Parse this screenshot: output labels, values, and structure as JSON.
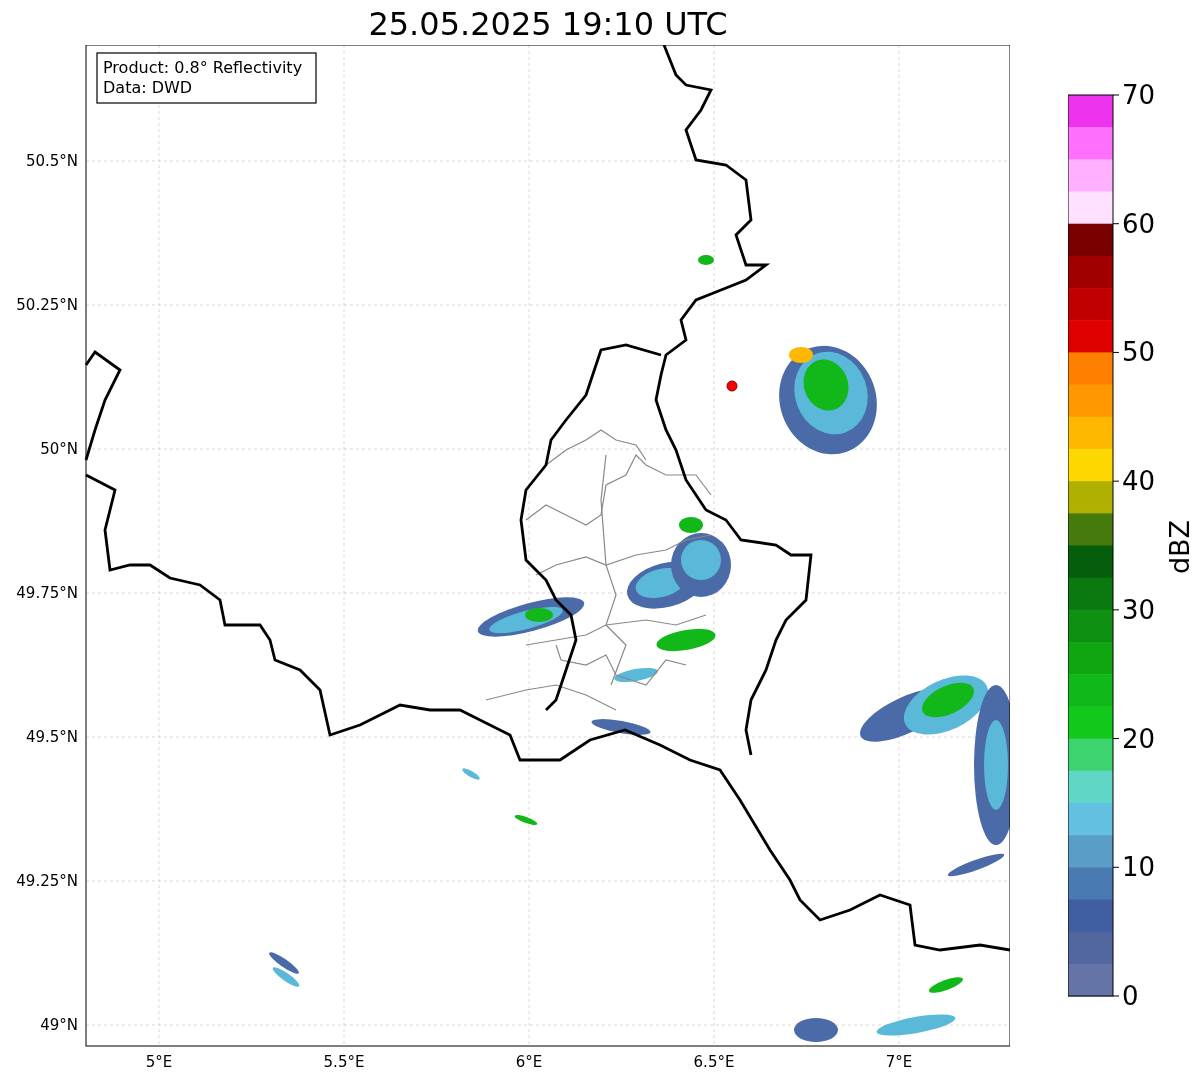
{
  "title": "25.05.2025 19:10 UTC",
  "info_box": {
    "lines": [
      "Product: 0.8° Reflectivity",
      "Data: DWD"
    ]
  },
  "map": {
    "x_ticks": [
      "5°E",
      "5.5°E",
      "6°E",
      "6.5°E",
      "7°E"
    ],
    "y_ticks": [
      "50.5°N",
      "50.25°N",
      "50°N",
      "49.75°N",
      "49.5°N",
      "49.25°N",
      "49°N"
    ]
  },
  "colorbar": {
    "label": "dBZ",
    "ticks": [
      "70",
      "60",
      "50",
      "40",
      "30",
      "20",
      "10",
      "0"
    ],
    "bins": [
      {
        "color": "#ee33ee"
      },
      {
        "color": "#ff70ff"
      },
      {
        "color": "#ffb0ff"
      },
      {
        "color": "#ffe0ff"
      },
      {
        "color": "#780000"
      },
      {
        "color": "#a00000"
      },
      {
        "color": "#c00000"
      },
      {
        "color": "#e00000"
      },
      {
        "color": "#ff8000"
      },
      {
        "color": "#ff9800"
      },
      {
        "color": "#ffb800"
      },
      {
        "color": "#ffd700"
      },
      {
        "color": "#b0b000"
      },
      {
        "color": "#467a0c"
      },
      {
        "color": "#065e0c"
      },
      {
        "color": "#0a7a10"
      },
      {
        "color": "#0e9012"
      },
      {
        "color": "#10a612"
      },
      {
        "color": "#10b81a"
      },
      {
        "color": "#12c81a"
      },
      {
        "color": "#3cd46e"
      },
      {
        "color": "#60d6c6"
      },
      {
        "color": "#64c0e0"
      },
      {
        "color": "#5a9ec8"
      },
      {
        "color": "#4a7ab2"
      },
      {
        "color": "#425ea2"
      },
      {
        "color": "#5266a0"
      },
      {
        "color": "#6474a6"
      }
    ]
  }
}
